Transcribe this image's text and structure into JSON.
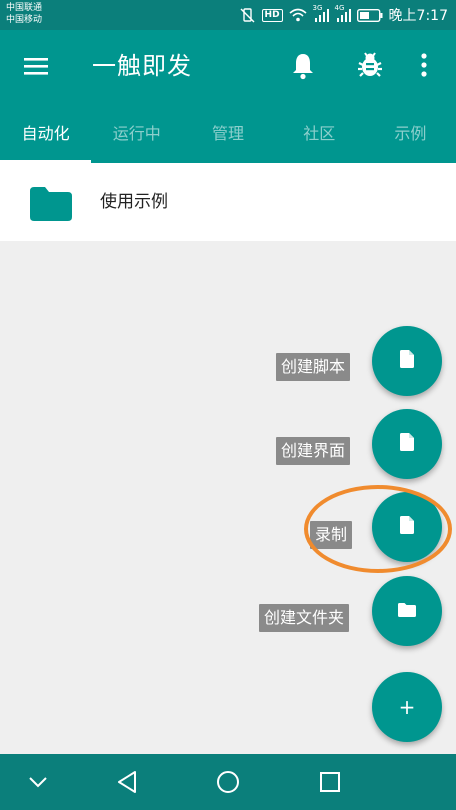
{
  "status_bar": {
    "carrier_1": "中国联通",
    "carrier_2": "中国移动",
    "hd_badge": "HD",
    "signal_1_label": "3G",
    "signal_2_label": "4G",
    "time": "晚上7:17",
    "icons": [
      "mute-vibrate-icon",
      "hd-voice-icon",
      "wifi-icon",
      "signal-3g-icon",
      "signal-4g-icon",
      "battery-icon"
    ]
  },
  "appbar": {
    "title": "一触即发",
    "icons": [
      "menu-icon",
      "bell-icon",
      "bug-icon",
      "more-vert-icon"
    ]
  },
  "tabs": [
    {
      "label": "自动化",
      "active": true
    },
    {
      "label": "运行中",
      "active": false
    },
    {
      "label": "管理",
      "active": false
    },
    {
      "label": "社区",
      "active": false
    },
    {
      "label": "示例",
      "active": false
    }
  ],
  "list": [
    {
      "label": "使用示例",
      "icon": "folder-icon"
    }
  ],
  "fab_menu": [
    {
      "label": "创建脚本",
      "icon": "file-icon"
    },
    {
      "label": "创建界面",
      "icon": "file-icon"
    },
    {
      "label": "录制",
      "icon": "file-icon"
    },
    {
      "label": "创建文件夹",
      "icon": "folder-icon"
    }
  ],
  "fab_main": {
    "symbol": "+",
    "icon": "plus-icon"
  },
  "navbar": {
    "icons": [
      "nav-collapse-icon",
      "back-icon",
      "home-icon",
      "recents-icon"
    ]
  },
  "colors": {
    "primary": "#00968f",
    "primary_dark": "#0b7f7b",
    "highlight": "#f08b2e",
    "label_bg": "#8a8a8a"
  }
}
